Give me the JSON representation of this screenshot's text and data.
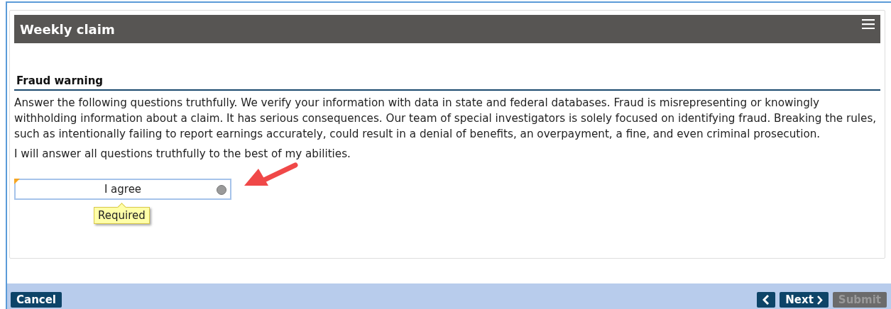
{
  "header": {
    "title": "Weekly claim"
  },
  "section": {
    "title": "Fraud warning",
    "paragraphs": [
      "Answer the following questions truthfully. We verify your information with data in state and federal databases. Fraud is misrepresenting or knowingly withholding information about a claim. It has serious consequences. Our team of special investigators is solely focused on identifying fraud. Breaking the rules, such as intentionally failing to report earnings accurately, could result in a denial of benefits, an overpayment, a fine, and even criminal prosecution.",
      "I will answer all questions truthfully to the best of my abilities."
    ]
  },
  "option": {
    "label": "I agree",
    "selected": false,
    "required": true
  },
  "tooltip": "Required",
  "footer": {
    "left_buttons": [
      {
        "kind": "text",
        "label": "Cancel",
        "disabled": false
      }
    ],
    "right_buttons": [
      {
        "kind": "prev",
        "disabled": false
      },
      {
        "kind": "next",
        "label": "Next",
        "disabled": false
      },
      {
        "kind": "text",
        "label": "Submit",
        "disabled": true
      }
    ]
  }
}
